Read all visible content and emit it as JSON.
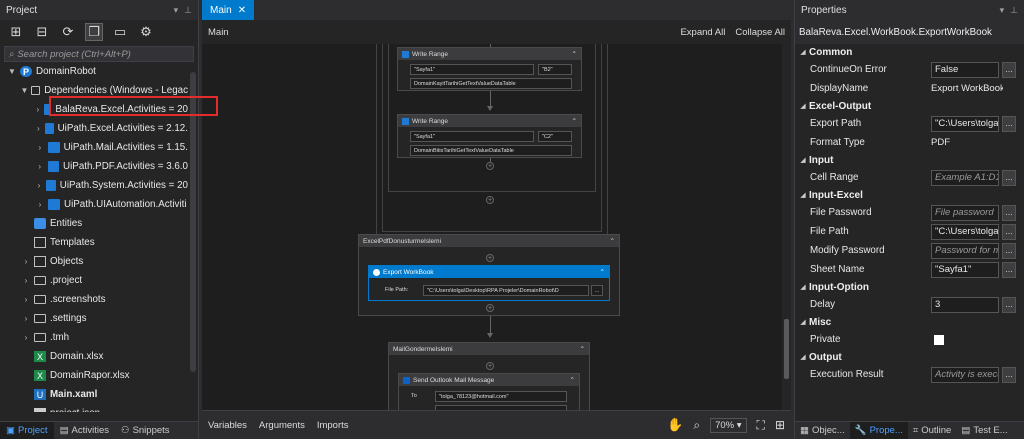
{
  "project_panel": {
    "title": "Project",
    "search_placeholder": "Search project (Ctrl+Alt+P)",
    "tree": [
      {
        "label": "DomainRobot",
        "icon": "robot-icon",
        "indent": 0,
        "chev": "▼",
        "bold": false
      },
      {
        "label": "Dependencies (Windows - Legac",
        "icon": "folder-icon",
        "indent": 1,
        "chev": "▼",
        "bold": false
      },
      {
        "label": "BalaReva.Excel.Activities = 20",
        "icon": "package-icon",
        "indent": 2,
        "chev": "›",
        "bold": false
      },
      {
        "label": "UiPath.Excel.Activities = 2.12.",
        "icon": "package-icon",
        "indent": 2,
        "chev": "›",
        "bold": false
      },
      {
        "label": "UiPath.Mail.Activities = 1.15.",
        "icon": "package-icon",
        "indent": 2,
        "chev": "›",
        "bold": false
      },
      {
        "label": "UiPath.PDF.Activities = 3.6.0",
        "icon": "package-icon",
        "indent": 2,
        "chev": "›",
        "bold": false
      },
      {
        "label": "UiPath.System.Activities = 20",
        "icon": "package-icon",
        "indent": 2,
        "chev": "›",
        "bold": false
      },
      {
        "label": "UiPath.UIAutomation.Activiti",
        "icon": "package-icon",
        "indent": 2,
        "chev": "›",
        "bold": false
      },
      {
        "label": "Entities",
        "icon": "entities-icon",
        "indent": 1,
        "chev": "",
        "bold": false
      },
      {
        "label": "Templates",
        "icon": "templates-icon",
        "indent": 1,
        "chev": "",
        "bold": false
      },
      {
        "label": "Objects",
        "icon": "objects-icon",
        "indent": 1,
        "chev": "›",
        "bold": false
      },
      {
        "label": ".project",
        "icon": "folder-icon",
        "indent": 1,
        "chev": "›",
        "bold": false
      },
      {
        "label": ".screenshots",
        "icon": "folder-icon",
        "indent": 1,
        "chev": "›",
        "bold": false
      },
      {
        "label": ".settings",
        "icon": "folder-icon",
        "indent": 1,
        "chev": "›",
        "bold": false
      },
      {
        "label": ".tmh",
        "icon": "folder-icon",
        "indent": 1,
        "chev": "›",
        "bold": false
      },
      {
        "label": "Domain.xlsx",
        "icon": "excel-file-icon",
        "indent": 1,
        "chev": "",
        "bold": false
      },
      {
        "label": "DomainRapor.xlsx",
        "icon": "excel-file-icon",
        "indent": 1,
        "chev": "",
        "bold": false
      },
      {
        "label": "Main.xaml",
        "icon": "xaml-file-icon",
        "indent": 1,
        "chev": "",
        "bold": true
      },
      {
        "label": "project.json",
        "icon": "json-file-icon",
        "indent": 1,
        "chev": "",
        "bold": false
      }
    ],
    "bottom_tabs": [
      {
        "label": "Project",
        "active": true
      },
      {
        "label": "Activities",
        "active": false
      },
      {
        "label": "Snippets",
        "active": false
      }
    ]
  },
  "designer": {
    "tab_label": "Main",
    "breadcrumb": "Main",
    "expand_all": "Expand All",
    "collapse_all": "Collapse All",
    "write_range_1": {
      "title": "Write Range",
      "sheet": "\"Sayfa1\"",
      "cell": "\"B2\"",
      "table": "DomainKayitTarihiGetTextValueDataTable"
    },
    "write_range_2": {
      "title": "Write Range",
      "sheet": "\"Sayfa1\"",
      "cell": "\"C2\"",
      "table": "DomainBitisTarihiGetTextValueDataTable"
    },
    "excel_pdf_seq": {
      "title": "ExcelPdfDonusturmeIslemi"
    },
    "export_workbook": {
      "title": "Export WorkBook",
      "file_path_label": "File Path:",
      "file_path_value": "\"C:\\Users\\tolga\\Desktop\\RPA Projeler\\DomainRobot\\D",
      "browse": "..."
    },
    "mail_seq": {
      "title": "MailGondermeIslemi"
    },
    "send_outlook": {
      "title": "Send Outlook Mail Message",
      "to_label": "To",
      "to_value": "\"tolga_78123@hotmail.com\""
    },
    "bottom": {
      "variables": "Variables",
      "arguments": "Arguments",
      "imports": "Imports",
      "zoom": "70%"
    }
  },
  "properties": {
    "header": "Properties",
    "activity_type": "BalaReva.Excel.WorkBook.ExportWorkBook",
    "categories": [
      {
        "name": "Common",
        "props": [
          {
            "name": "ContinueOn Error",
            "value": "False",
            "kind": "box",
            "more": true
          },
          {
            "name": "DisplayName",
            "value": "Export WorkBook",
            "kind": "plain",
            "more": false
          }
        ]
      },
      {
        "name": "Excel-Output",
        "props": [
          {
            "name": "Export Path",
            "value": "\"C:\\Users\\tolga",
            "kind": "box",
            "more": true
          },
          {
            "name": "Format Type",
            "value": "PDF",
            "kind": "plain",
            "more": false
          }
        ]
      },
      {
        "name": "Input",
        "props": [
          {
            "name": "Cell Range",
            "value": "Example A1:D1",
            "kind": "placeholder",
            "more": true
          }
        ]
      },
      {
        "name": "Input-Excel",
        "props": [
          {
            "name": "File Password",
            "value": "File password",
            "kind": "placeholder",
            "more": true
          },
          {
            "name": "File Path",
            "value": "\"C:\\Users\\tolga",
            "kind": "box",
            "more": true
          },
          {
            "name": "Modify Password",
            "value": "Password for m",
            "kind": "placeholder",
            "more": true
          },
          {
            "name": "Sheet Name",
            "value": "\"Sayfa1\"",
            "kind": "box",
            "more": true
          }
        ]
      },
      {
        "name": "Input-Option",
        "props": [
          {
            "name": "Delay",
            "value": "3",
            "kind": "box",
            "more": true
          }
        ]
      },
      {
        "name": "Misc",
        "props": [
          {
            "name": "Private",
            "value": "",
            "kind": "checkbox",
            "more": false
          }
        ]
      },
      {
        "name": "Output",
        "props": [
          {
            "name": "Execution Result",
            "value": "Activity is execu",
            "kind": "placeholder",
            "more": true
          }
        ]
      }
    ],
    "bottom_tabs": [
      {
        "label": "Objec...",
        "active": false
      },
      {
        "label": "Prope...",
        "active": true
      },
      {
        "label": "Outline",
        "active": false
      },
      {
        "label": "Test E...",
        "active": false
      }
    ]
  }
}
